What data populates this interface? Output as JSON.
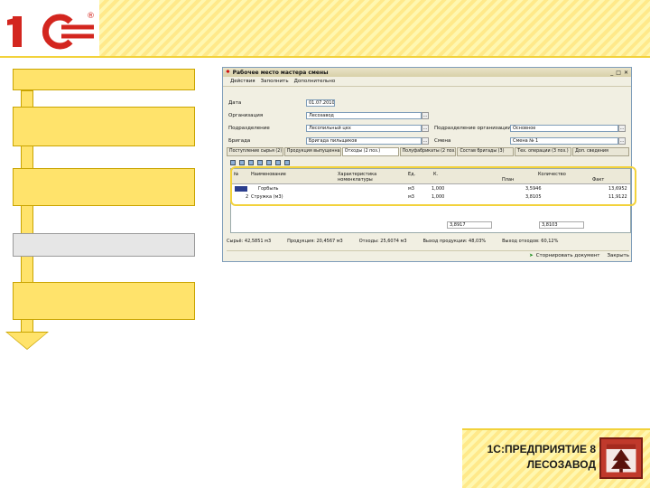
{
  "logo": {
    "text": "1С",
    "mark": "®"
  },
  "window": {
    "title": "Рабочее место мастера смены",
    "menu": [
      "Действия",
      "Заполнить",
      "Дополнительно"
    ],
    "fields": {
      "date_label": "Дата",
      "date_value": "01.07.2010",
      "org_label": "Организация",
      "org_value": "Лесозавод",
      "dept_label": "Подразделение",
      "dept_value": "Лесопильный цех",
      "brigade_label": "Бригада",
      "brigade_value": "Бригада пильщиков",
      "right_label1": "Подразделение организации",
      "right_value1": "Основное",
      "right_label2": "Смена",
      "right_value2": "Смена № 1"
    },
    "tabs": [
      "Поступление сырья (2)",
      "Продукция выпущенная (3)",
      "Отходы (2 поз.)",
      "Полуфабрикаты (2 поз.)",
      "Состав бригады (3)",
      "Тех. операции (3 поз.)",
      "Доп. сведения"
    ],
    "grid": {
      "headers": [
        "№",
        "Наименование",
        "Характеристика номенклатуры",
        "Ед.",
        "К.",
        "План",
        "Количество",
        "Факт"
      ],
      "rows": [
        {
          "n": "1",
          "name": "Горбыль",
          "unit": "м3",
          "k": "1,000",
          "plan": "3,5946",
          "fact": "13,6952"
        },
        {
          "n": "2",
          "name": "Стружка (м3)",
          "unit": "м3",
          "k": "1,000",
          "plan": "3,8105",
          "fact": "11,9122"
        }
      ],
      "totals": [
        "3,8917",
        "3,8103"
      ]
    },
    "status": [
      "Сырьё: 42,5851 м3",
      "Продукция: 20,4567 м3",
      "Отходы: 25,6074 м3",
      "Выход продукции: 48,03%",
      "Выход отходов: 60,12%"
    ],
    "bottom": {
      "post": "Сторнировать документ",
      "close": "Закрыть"
    }
  },
  "brand": {
    "line1": "1С:ПРЕДПРИЯТИЕ 8",
    "line2": "ЛЕСОЗАВОД"
  },
  "colors": {
    "accent": "#ffe36b",
    "border": "#c9a400",
    "highlight": "#f2d23b"
  }
}
